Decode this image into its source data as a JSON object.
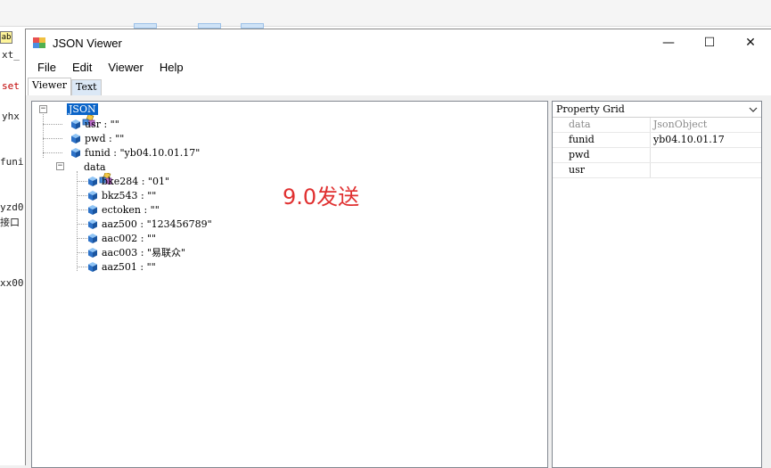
{
  "background": {
    "ab_badge": "ab",
    "left_lines": [
      "xt_",
      "set",
      "yhx",
      "funi",
      "yzd0",
      "接口",
      "xx00"
    ]
  },
  "window": {
    "title": "JSON Viewer",
    "controls": {
      "minimize": "—",
      "maximize": "☐",
      "close": "✕"
    }
  },
  "menu": {
    "items": [
      "File",
      "Edit",
      "Viewer",
      "Help"
    ]
  },
  "tabs": {
    "items": [
      "Viewer",
      "Text"
    ]
  },
  "tree": {
    "root": "JSON",
    "nodes": [
      {
        "key": "usr",
        "value": "usr : \"\""
      },
      {
        "key": "pwd",
        "value": "pwd : \"\""
      },
      {
        "key": "funid",
        "value": "funid : \"yb04.10.01.17\""
      },
      {
        "key": "data",
        "value": "data"
      }
    ],
    "data_children": [
      "bke284 : \"01\"",
      "bkz543 : \"\"",
      "ectoken : \"\"",
      "aaz500 : \"123456789\"",
      "aac002 : \"\"",
      "aac003 : \"易联众\"",
      "aaz501 : \"\""
    ]
  },
  "overlay_note": "9.0发送",
  "property_grid": {
    "title": "Property Grid",
    "rows": [
      {
        "key": "data",
        "value": "JsonObject"
      },
      {
        "key": "funid",
        "value": "yb04.10.01.17"
      },
      {
        "key": "pwd",
        "value": ""
      },
      {
        "key": "usr",
        "value": ""
      }
    ]
  }
}
